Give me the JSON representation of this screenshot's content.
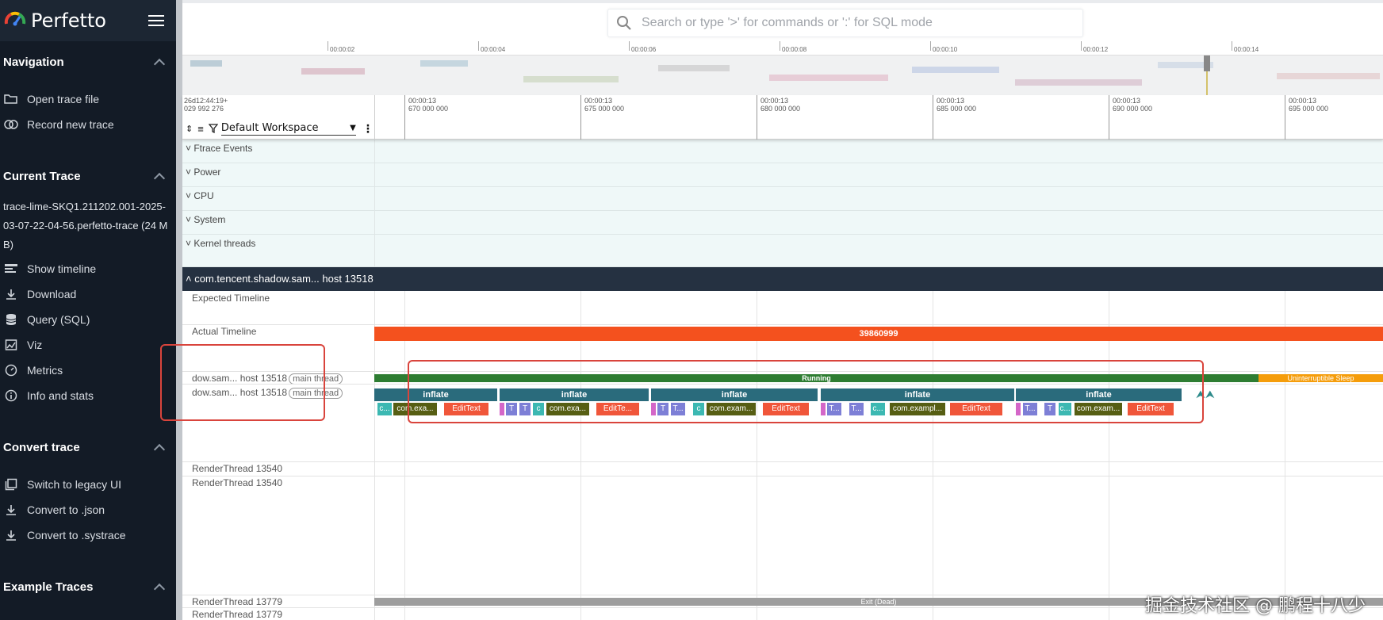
{
  "app": {
    "name": "Perfetto"
  },
  "search": {
    "placeholder": "Search or type '>' for commands or ':' for SQL mode"
  },
  "sidebar": {
    "navigation": {
      "title": "Navigation",
      "items": [
        {
          "label": "Open trace file",
          "icon": "folder-open-icon"
        },
        {
          "label": "Record new trace",
          "icon": "record-icon"
        }
      ]
    },
    "current_trace": {
      "title": "Current Trace",
      "trace_name": "trace-lime-SKQ1.211202.001-2025-03-07-22-04-56.perfetto-trace (24 MB)",
      "items": [
        {
          "label": "Show timeline",
          "icon": "timeline-icon"
        },
        {
          "label": "Download",
          "icon": "download-icon"
        },
        {
          "label": "Query (SQL)",
          "icon": "database-icon"
        },
        {
          "label": "Viz",
          "icon": "viz-icon"
        },
        {
          "label": "Metrics",
          "icon": "metrics-icon"
        },
        {
          "label": "Info and stats",
          "icon": "info-icon"
        }
      ]
    },
    "convert_trace": {
      "title": "Convert trace",
      "items": [
        {
          "label": "Switch to legacy UI",
          "icon": "legacy-ui-icon"
        },
        {
          "label": "Convert to .json",
          "icon": "download-icon"
        },
        {
          "label": "Convert to .systrace",
          "icon": "download-icon"
        }
      ]
    },
    "example_traces": {
      "title": "Example Traces"
    }
  },
  "overview_ticks": [
    "00:00:02",
    "00:00:04",
    "00:00:06",
    "00:00:08",
    "00:00:10",
    "00:00:12",
    "00:00:14"
  ],
  "time_axis": {
    "origin_line1": "26d12:44:19+",
    "origin_line2": "029 992 276",
    "ticks": [
      {
        "l1": "00:00:13",
        "l2": "670 000 000"
      },
      {
        "l1": "00:00:13",
        "l2": "675 000 000"
      },
      {
        "l1": "00:00:13",
        "l2": "680 000 000"
      },
      {
        "l1": "00:00:13",
        "l2": "685 000 000"
      },
      {
        "l1": "00:00:13",
        "l2": "690 000 000"
      },
      {
        "l1": "00:00:13",
        "l2": "695 000 000"
      }
    ],
    "workspace": "Default Workspace"
  },
  "groups": [
    "Ftrace Events",
    "Power",
    "CPU",
    "System",
    "Kernel threads"
  ],
  "process": {
    "header": "com.tencent.shadow.sam... host 13518",
    "tracks": {
      "expected_timeline": "Expected Timeline",
      "actual_timeline": "Actual Timeline",
      "main_thread_1": "dow.sam... host 13518",
      "main_thread_2": "dow.sam... host 13518",
      "main_thread_pill": "main thread",
      "render_thread_1": "RenderThread 13540",
      "render_thread_2": "RenderThread 13540",
      "render_thread_3": "RenderThread 13779",
      "render_thread_4": "RenderThread 13779"
    },
    "slices": {
      "actual_frame": "39860999",
      "running": "Running",
      "uninterruptible": "Uninterruptible Sleep",
      "exit_dead": "Exit (Dead)",
      "inflate": "inflate",
      "sub_1": [
        "c...",
        "com.exa...",
        "EditText"
      ],
      "sub_2": [
        "T",
        "T",
        "c",
        "com.exa...",
        "EditTe..."
      ],
      "sub_3": [
        "T",
        "T...",
        "c",
        "com.exam...",
        "EditText"
      ],
      "sub_4": [
        "T...",
        "T...",
        "c...",
        "com.exampl...",
        "EditText"
      ],
      "sub_5": [
        "T...",
        "T",
        "c...",
        "com.exam...",
        "EditText"
      ]
    }
  },
  "colors": {
    "sidebar_bg": "#131b26",
    "actual_frame": "#f4511e",
    "running": "#2e7d32",
    "uninterruptible": "#f59d0b",
    "inflate": "#2a6b7c",
    "edittext": "#f0563a",
    "com_exa": "#565e13",
    "t_slice": "#7d7fd6",
    "c_slice": "#3cb8b2",
    "highlight_box": "#d9443c"
  },
  "watermark": "掘金技术社区 @ 鹏程十八少"
}
